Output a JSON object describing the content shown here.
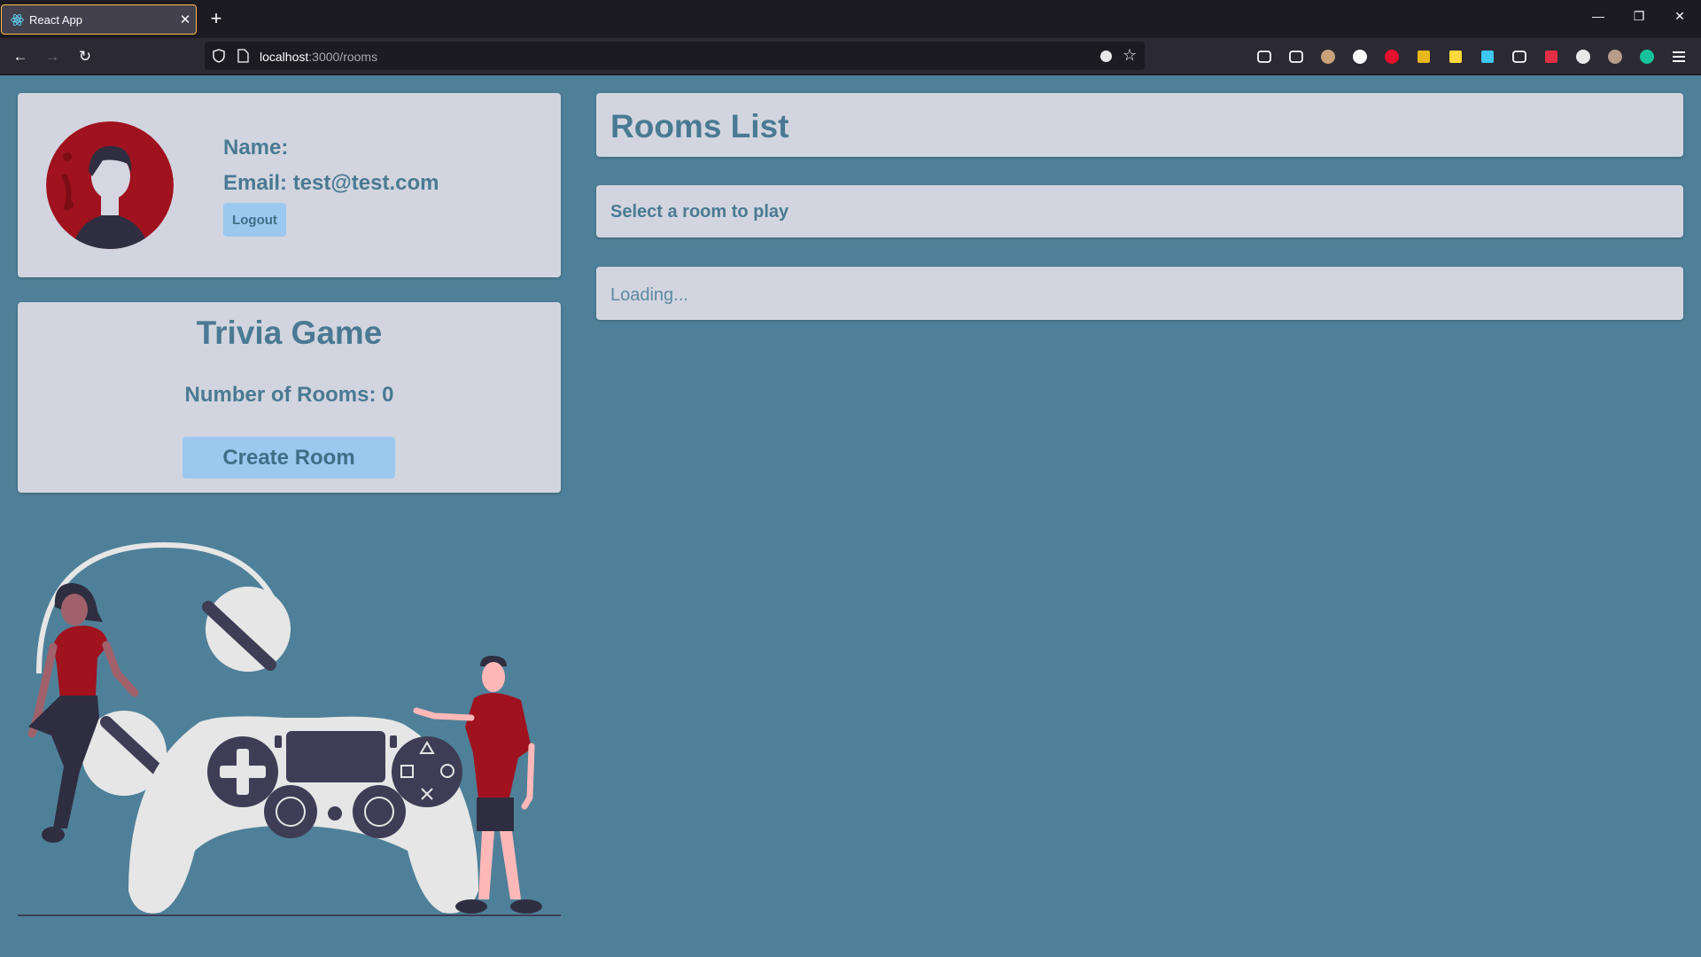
{
  "browser": {
    "tab_title": "React App",
    "url_host": "localhost",
    "url_path": ":3000/rooms",
    "extensions": [
      "pocket-icon",
      "download-icon",
      "avatar-ext-icon",
      "cookie-icon",
      "adblock-icon",
      "library-icon",
      "notes-icon",
      "save-icon",
      "screen-icon",
      "shield-ext-icon",
      "circle-ext-icon",
      "mask-ext-icon",
      "grammarly-icon",
      "menu-icon"
    ]
  },
  "profile": {
    "name_label": "Name:",
    "email_text": "Email: test@test.com",
    "logout_label": "Logout"
  },
  "trivia": {
    "title": "Trivia Game",
    "rooms_count_text": "Number of Rooms: 0",
    "create_label": "Create Room"
  },
  "rooms_list": {
    "title": "Rooms List",
    "subtitle": "Select a room to play",
    "status": "Loading..."
  },
  "colors": {
    "background": "#4f8099",
    "card": "#d2d5df",
    "accent_text": "#4a7a93",
    "button": "#9ac8ee",
    "illustration_red": "#a0121e"
  }
}
